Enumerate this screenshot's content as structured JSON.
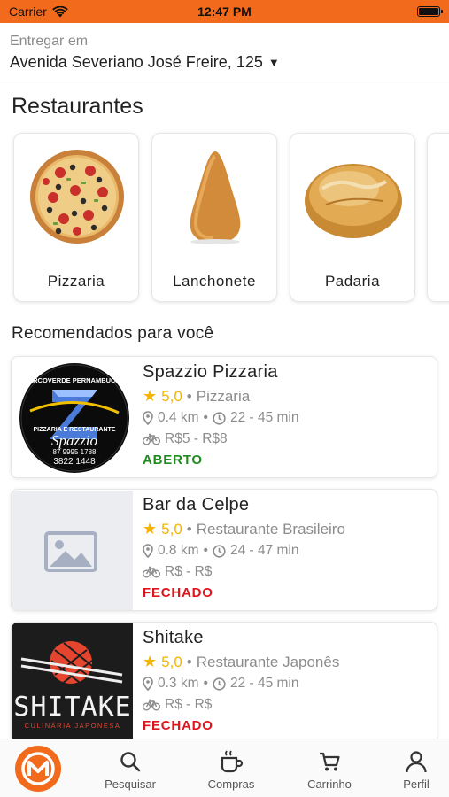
{
  "status_bar": {
    "carrier": "Carrier",
    "time": "12:47 PM"
  },
  "address": {
    "label": "Entregar em",
    "value": "Avenida Severiano José Freire, 125"
  },
  "section_title": "Restaurantes",
  "categories": [
    {
      "name": "Pizzaria",
      "icon": "pizza-image"
    },
    {
      "name": "Lanchonete",
      "icon": "coxinha-image"
    },
    {
      "name": "Padaria",
      "icon": "bread-image"
    }
  ],
  "recommended_title": "Recomendados para você",
  "restaurants": [
    {
      "name": "Spazzio Pizzaria",
      "rating": "5,0",
      "category": "Pizzaria",
      "distance": "0.4 km",
      "time": "22 - 45 min",
      "delivery_fee": "R$5 - R$8",
      "status": "ABERTO",
      "status_color": "#1e8c1e",
      "logo": {
        "top": "ARCOVERDE PERNAMBUCO",
        "mid": "PIZZARIA E RESTAURANTE",
        "brand": "Spazzio",
        "phone1": "87 9995 1788",
        "phone2": "3822 1448"
      }
    },
    {
      "name": "Bar da Celpe",
      "rating": "5,0",
      "category": "Restaurante Brasileiro",
      "distance": "0.8 km",
      "time": "24 - 47 min",
      "delivery_fee": "R$ - R$",
      "status": "FECHADO",
      "status_color": "#e0141e"
    },
    {
      "name": "Shitake",
      "rating": "5,0",
      "category": "Restaurante Japonês",
      "distance": "0.3 km",
      "time": "22 - 45 min",
      "delivery_fee": "R$ - R$",
      "status": "FECHADO",
      "status_color": "#e0141e",
      "logo": {
        "brand": "SHITAKE",
        "sub": "CULINÁRIA JAPONESA"
      }
    }
  ],
  "tabs": [
    {
      "label": "",
      "icon": "app-logo-icon"
    },
    {
      "label": "Pesquisar",
      "icon": "search-icon"
    },
    {
      "label": "Compras",
      "icon": "coffee-cup-icon"
    },
    {
      "label": "Carrinho",
      "icon": "cart-icon"
    },
    {
      "label": "Perfil",
      "icon": "user-icon"
    }
  ],
  "colors": {
    "accent": "#f26a1b",
    "star": "#f5b400",
    "open": "#1e8c1e",
    "closed": "#e0141e"
  }
}
